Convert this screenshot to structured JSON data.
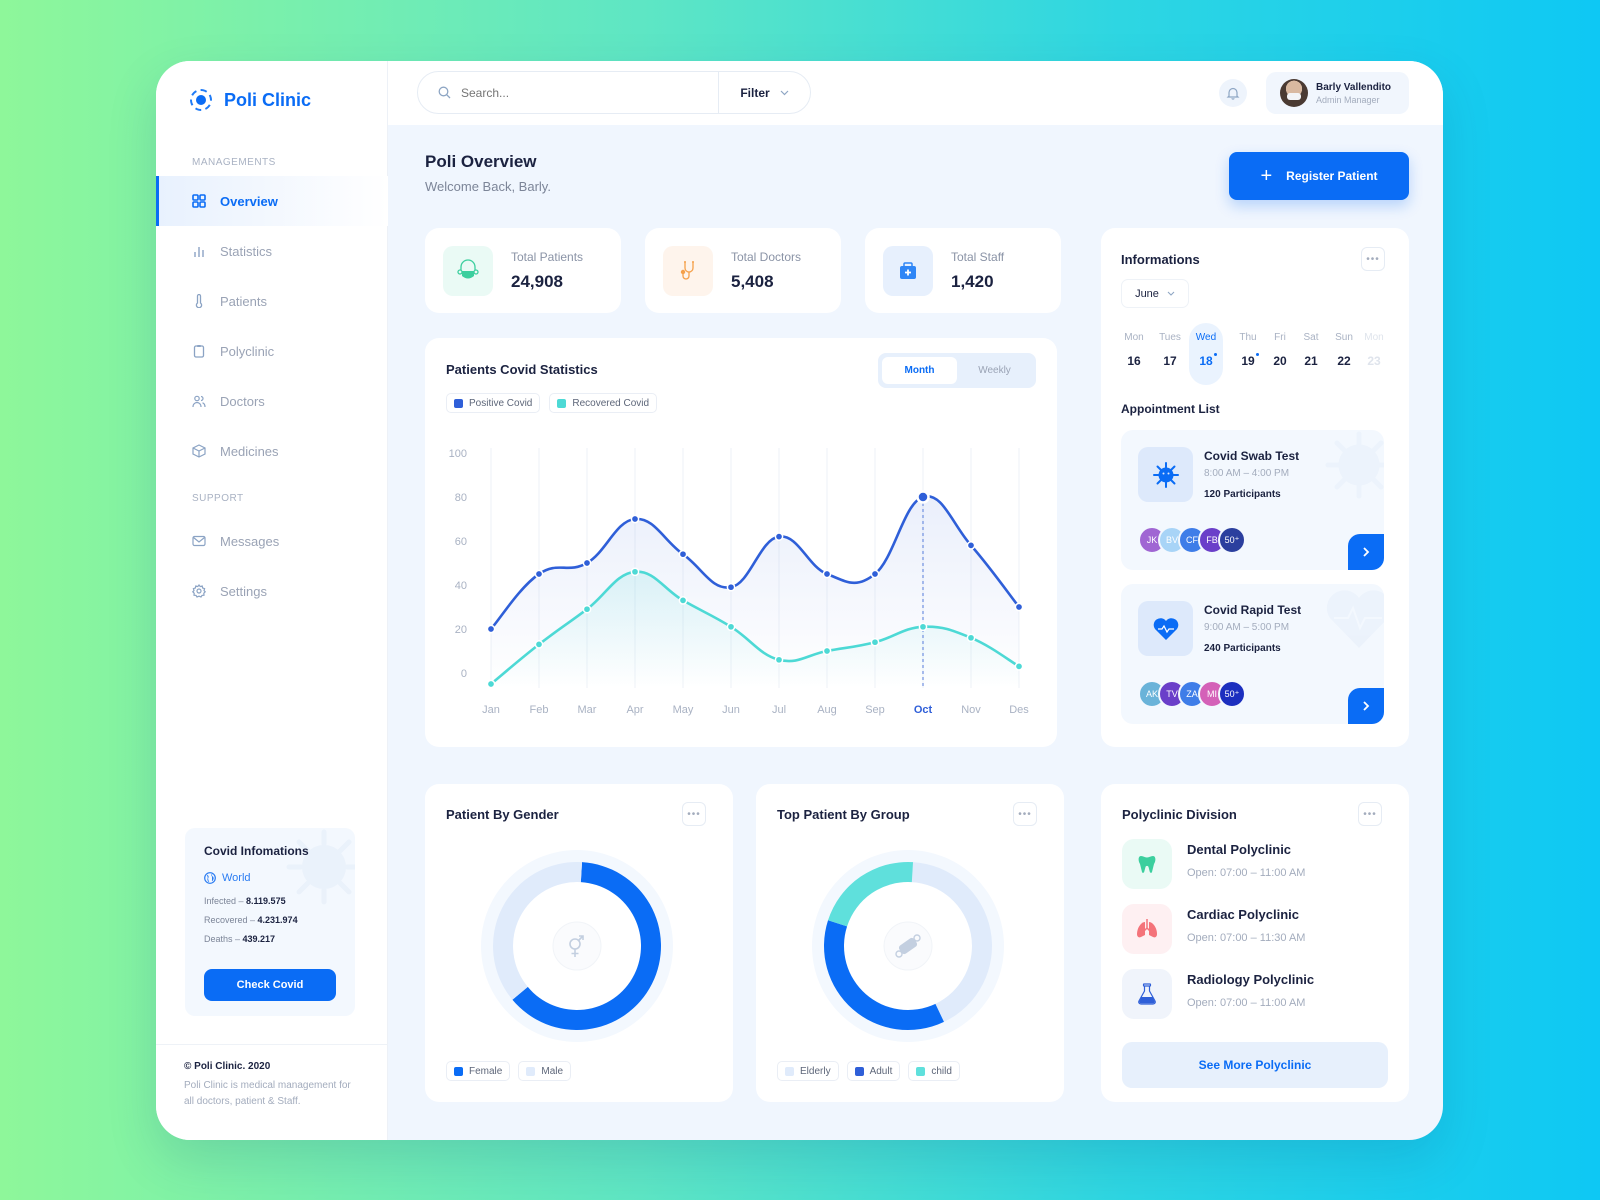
{
  "brand": {
    "name": "Poli Clinic"
  },
  "sidebar": {
    "section_managements": "MANAGEMENTS",
    "section_support": "SUPPORT",
    "items": [
      {
        "label": "Overview",
        "icon": "grid-icon",
        "active": true
      },
      {
        "label": "Statistics",
        "icon": "bar-chart-icon"
      },
      {
        "label": "Patients",
        "icon": "thermometer-icon"
      },
      {
        "label": "Polyclinic",
        "icon": "clipboard-icon"
      },
      {
        "label": "Doctors",
        "icon": "users-icon"
      },
      {
        "label": "Medicines",
        "icon": "box-icon"
      }
    ],
    "support_items": [
      {
        "label": "Messages",
        "icon": "mail-icon"
      },
      {
        "label": "Settings",
        "icon": "gear-icon"
      }
    ],
    "covid": {
      "title": "Covid Infomations",
      "region": "World",
      "infected_label": "Infected – ",
      "infected": "8.119.575",
      "recovered_label": "Recovered – ",
      "recovered": "4.231.974",
      "deaths_label": "Deaths – ",
      "deaths": "439.217",
      "button": "Check Covid"
    },
    "footer": {
      "copyright": "© Poli Clinic. 2020",
      "description": "Poli Clinic is medical management for all doctors, patient & Staff."
    }
  },
  "topbar": {
    "search_placeholder": "Search...",
    "filter_label": "Filter",
    "user": {
      "name": "Barly Vallendito",
      "role": "Admin Manager"
    }
  },
  "header": {
    "title": "Poli Overview",
    "subtitle": "Welcome Back, Barly.",
    "register_button": "Register Patient"
  },
  "stats": [
    {
      "label": "Total Patients",
      "value": "24,908",
      "icon": "mask-icon",
      "bg": "#eafaf5",
      "color": "#3ccf9e"
    },
    {
      "label": "Total Doctors",
      "value": "5,408",
      "icon": "stethoscope-icon",
      "bg": "#fef4ec",
      "color": "#f5a04a"
    },
    {
      "label": "Total Staff",
      "value": "1,420",
      "icon": "medkit-icon",
      "bg": "#e7f0fd",
      "color": "#2f86f6"
    }
  ],
  "covid_chart": {
    "title": "Patients Covid Statistics",
    "toggle": [
      "Month",
      "Weekly"
    ],
    "toggle_active": "Month"
  },
  "chart_data": [
    {
      "type": "line",
      "title": "Patients Covid Statistics",
      "categories": [
        "Jan",
        "Feb",
        "Mar",
        "Apr",
        "May",
        "Jun",
        "Jul",
        "Aug",
        "Sep",
        "Oct",
        "Nov",
        "Des"
      ],
      "highlight_category": "Oct",
      "ylim": [
        0,
        100
      ],
      "yticks": [
        0,
        20,
        40,
        60,
        80,
        100
      ],
      "grid": "vertical",
      "legend": "top-left",
      "series": [
        {
          "name": "Positive Covid",
          "color": "#2f5fd8",
          "values": [
            20,
            45,
            50,
            70,
            54,
            39,
            62,
            45,
            45,
            80,
            58,
            30
          ]
        },
        {
          "name": "Recovered Covid",
          "color": "#4dd9d5",
          "values": [
            -5,
            13,
            29,
            46,
            33,
            21,
            6,
            10,
            14,
            21,
            16,
            3
          ]
        }
      ]
    },
    {
      "type": "pie",
      "title": "Patient By Gender",
      "categories": [
        "Female",
        "Male"
      ],
      "values": [
        63,
        37
      ],
      "colors": [
        "#0a6cf5",
        "#e0ebfb"
      ],
      "legend": "bottom-left"
    },
    {
      "type": "pie",
      "title": "Top Patient By Group",
      "categories": [
        "Elderly",
        "Adult",
        "child"
      ],
      "values": [
        42,
        37,
        21
      ],
      "colors": [
        "#e0ebfb",
        "#0a6cf5",
        "#5fe0dc"
      ],
      "legend_colors": [
        "#e0ebfb",
        "#2f5fd8",
        "#5fe0dc"
      ],
      "legend": "bottom-left"
    }
  ],
  "informations": {
    "title": "Informations",
    "month": "June",
    "days": [
      {
        "name": "Mon",
        "num": "16"
      },
      {
        "name": "Tues",
        "num": "17"
      },
      {
        "name": "Wed",
        "num": "18",
        "active": true,
        "dot": true
      },
      {
        "name": "Thu",
        "num": "19",
        "dot": true
      },
      {
        "name": "Fri",
        "num": "20"
      },
      {
        "name": "Sat",
        "num": "21"
      },
      {
        "name": "Sun",
        "num": "22"
      },
      {
        "name": "Mon",
        "num": "23",
        "faded": true
      }
    ],
    "appointment_label": "Appointment List",
    "appointments": [
      {
        "title": "Covid Swab Test",
        "time": "8:00 AM – 4:00 PM",
        "participants": "120 Participants",
        "icon": "virus-icon",
        "avatars": [
          {
            "initials": "JK",
            "color": "#a066d3"
          },
          {
            "initials": "BV",
            "color": "#a8d4f7"
          },
          {
            "initials": "CF",
            "color": "#3e7de8"
          },
          {
            "initials": "FB",
            "color": "#6a3fc9"
          },
          {
            "initials": "50⁺",
            "color": "#2b3f9e"
          }
        ]
      },
      {
        "title": "Covid Rapid Test",
        "time": "9:00 AM – 5:00 PM",
        "participants": "240 Participants",
        "icon": "heart-pulse-icon",
        "avatars": [
          {
            "initials": "AK",
            "color": "#6ab3d9"
          },
          {
            "initials": "TV",
            "color": "#6a3fc9"
          },
          {
            "initials": "ZA",
            "color": "#3e7de8"
          },
          {
            "initials": "MI",
            "color": "#d461b8"
          },
          {
            "initials": "50⁺",
            "color": "#1c2fbf"
          }
        ]
      }
    ]
  },
  "polyclinic": {
    "title": "Polyclinic Division",
    "items": [
      {
        "name": "Dental Polyclinic",
        "open": "Open: 07:00 – 11:00 AM",
        "icon": "tooth-icon",
        "bg": "#eafaf5",
        "color": "#3ccf9e"
      },
      {
        "name": "Cardiac Polyclinic",
        "open": "Open: 07:00 – 11:30 AM",
        "icon": "lungs-icon",
        "bg": "#fef0f2",
        "color": "#f4737a"
      },
      {
        "name": "Radiology Polyclinic",
        "open": "Open: 07:00 – 11:00 AM",
        "icon": "flask-icon",
        "bg": "#f0f4fb",
        "color": "#2f5fd8"
      }
    ],
    "see_more": "See More Polyclinic"
  }
}
